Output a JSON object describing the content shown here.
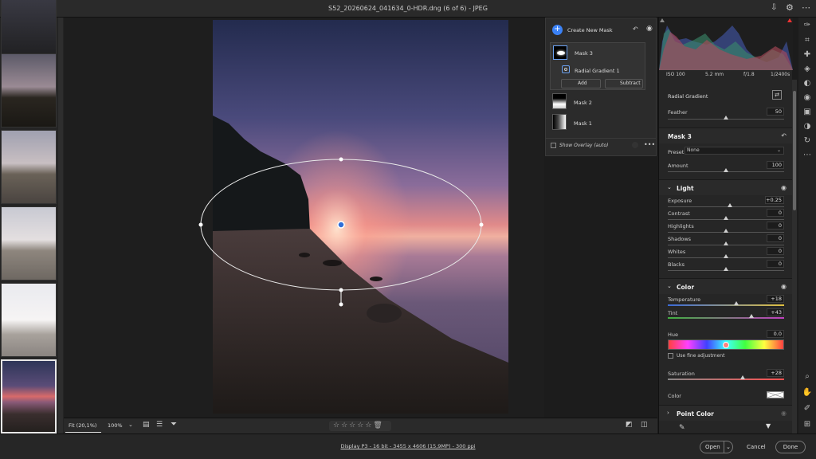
{
  "window": {
    "title": "S52_20260624_041634_0-HDR.dng (6 of 6)  -  JPEG"
  },
  "masks": {
    "create_label": "Create New Mask",
    "items": [
      {
        "label": "Mask 3"
      },
      {
        "label": "Radial Gradient 1"
      },
      {
        "label": "Mask 2"
      },
      {
        "label": "Mask 1"
      }
    ],
    "add_label": "Add",
    "subtract_label": "Subtract",
    "overlay_label": "Show Overlay (auto)",
    "more": "•••"
  },
  "histogram": {
    "iso": "ISO 100",
    "focal": "5.2 mm",
    "aperture": "f/1.8",
    "shutter": "1/2400s"
  },
  "radial": {
    "title": "Radial Gradient",
    "feather_label": "Feather",
    "feather_value": "50"
  },
  "mask3": {
    "title": "Mask 3",
    "preset_label": "Preset",
    "preset_value": "None",
    "amount_label": "Amount",
    "amount_value": "100"
  },
  "light": {
    "title": "Light",
    "sliders": [
      {
        "label": "Exposure",
        "value": "+0.25"
      },
      {
        "label": "Contrast",
        "value": "0"
      },
      {
        "label": "Highlights",
        "value": "0"
      },
      {
        "label": "Shadows",
        "value": "0"
      },
      {
        "label": "Whites",
        "value": "0"
      },
      {
        "label": "Blacks",
        "value": "0"
      }
    ]
  },
  "color": {
    "title": "Color",
    "temperature_label": "Temperature",
    "temperature_value": "+18",
    "tint_label": "Tint",
    "tint_value": "+43",
    "hue_label": "Hue",
    "hue_value": "0.0",
    "fine_label": "Use fine adjustment",
    "saturation_label": "Saturation",
    "saturation_value": "+28",
    "color_label": "Color"
  },
  "point_color": {
    "title": "Point Color"
  },
  "bottombar": {
    "fit": "Fit (20,1%)",
    "zoom": "100%"
  },
  "footer": {
    "info": "Display P3 - 16 bit - 3455 x 4606 (15,9MP) - 300 ppi",
    "open": "Open",
    "cancel": "Cancel",
    "done": "Done"
  },
  "colors": {
    "accent": "#3b82f6",
    "panel": "#262626"
  }
}
